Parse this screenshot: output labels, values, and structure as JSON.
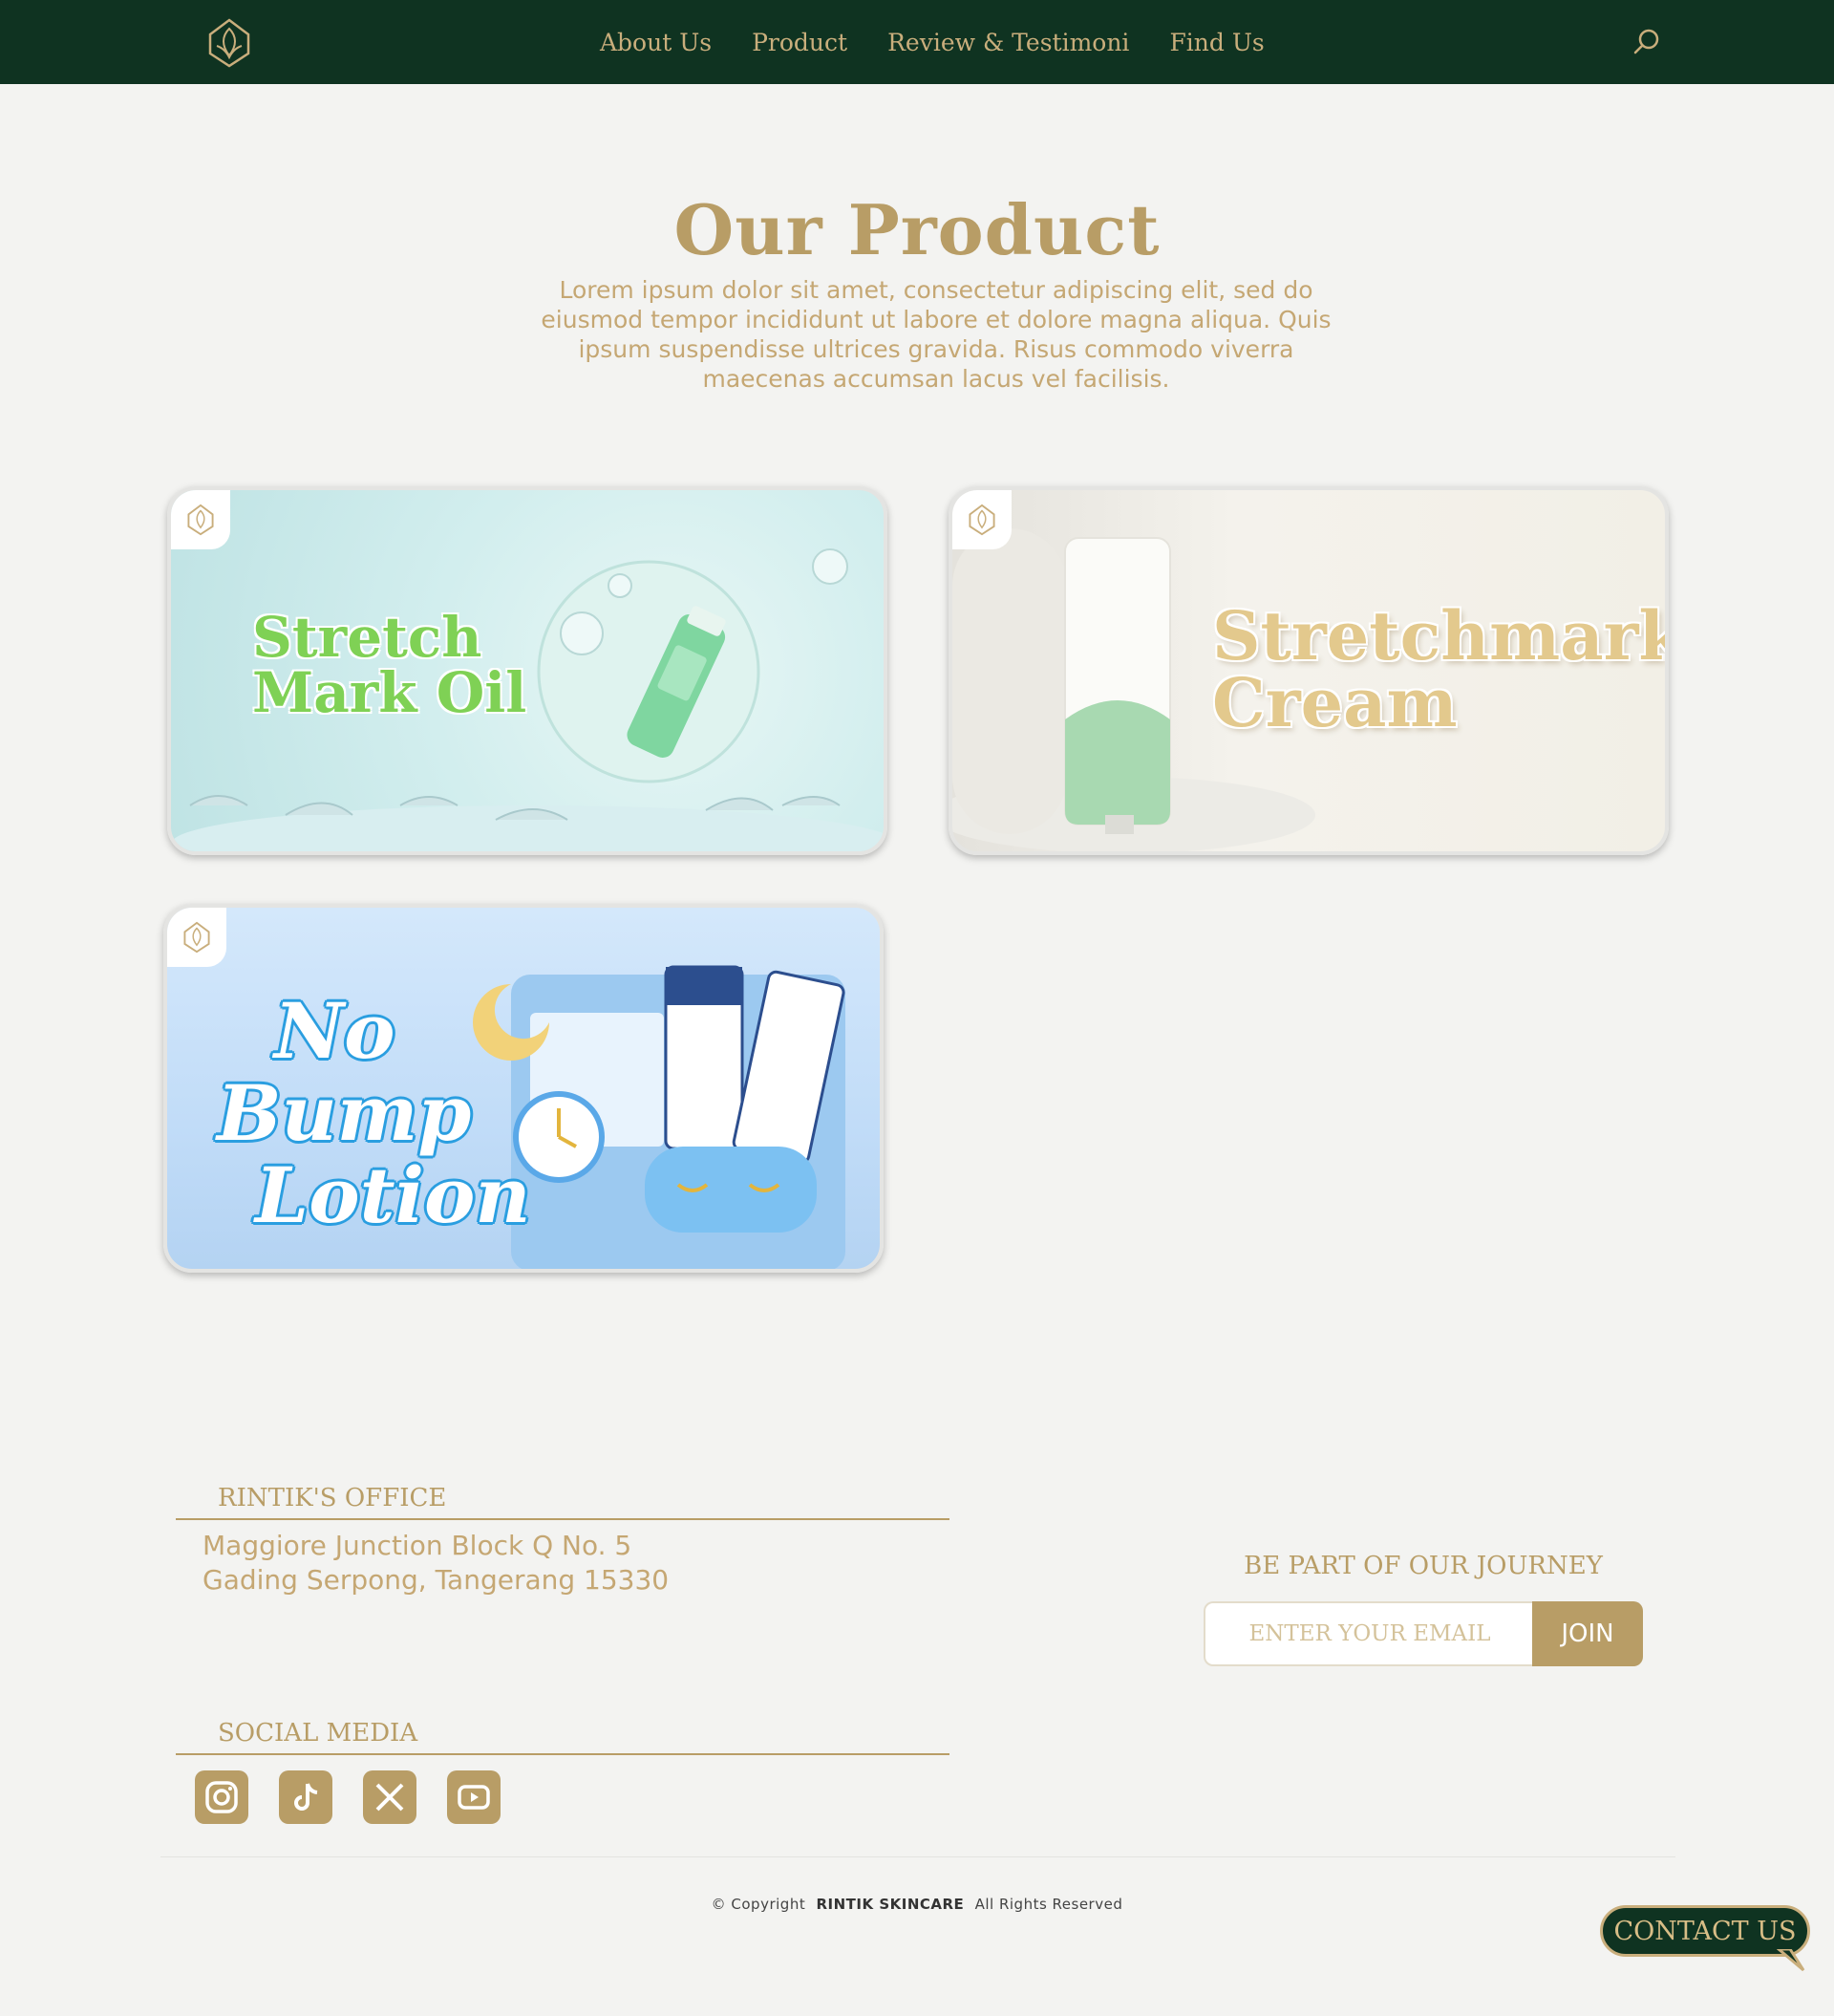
{
  "nav": {
    "logo": "rintik-leaf-logo",
    "links": [
      "About Us",
      "Product",
      "Review & Testimoni",
      "Find Us"
    ],
    "search_icon": "search-icon"
  },
  "hero": {
    "title": "Our Product",
    "description": "Lorem ipsum dolor sit amet, consectetur adipiscing elit, sed do eiusmod tempor incididunt ut labore et dolore magna aliqua. Quis ipsum suspendisse ultrices gravida. Risus commodo viverra maecenas accumsan lacus vel facilisis."
  },
  "products": [
    {
      "name_line1": "Stretch",
      "name_line2": "Mark Oil",
      "label_color": "#7fd155"
    },
    {
      "name_line1": "Stretchmark",
      "name_line2": "Cream",
      "label_color": "#e3c98d"
    },
    {
      "name_line1": "No",
      "name_line2": "Bump",
      "name_line3": "Lotion",
      "label_color": "#2a9ee0"
    }
  ],
  "footer": {
    "office_heading": "RINTIK'S OFFICE",
    "address_line1": "Maggiore Junction Block Q No. 5",
    "address_line2": "Gading Serpong, Tangerang 15330",
    "social_heading": "SOCIAL MEDIA",
    "socials": [
      "instagram-icon",
      "tiktok-icon",
      "x-icon",
      "youtube-icon"
    ],
    "journey_heading": "BE PART OF OUR JOURNEY",
    "email_placeholder": "ENTER YOUR EMAIL",
    "join_label": "JOIN",
    "copyright_prefix": "© Copyright",
    "copyright_brand": "RINTIK SKINCARE",
    "copyright_suffix": "All Rights Reserved",
    "contact_label": "CONTACT US"
  },
  "colors": {
    "nav_bg": "#0f3321",
    "gold": "#b89d66",
    "page_bg": "#f3f3f1"
  }
}
